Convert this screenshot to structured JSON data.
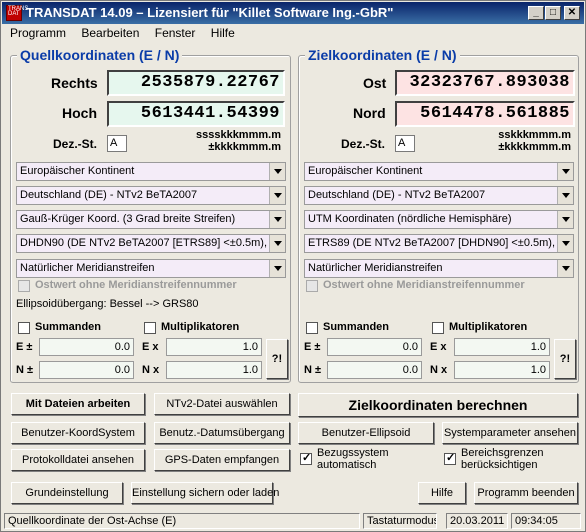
{
  "window": {
    "title": "TRANSDAT 14.09 – Lizensiert für \"Killet Software Ing.-GbR\"",
    "icon_text": "TRANS DAT",
    "minimize": "_",
    "maximize": "□",
    "close": "✕"
  },
  "menu": [
    "Programm",
    "Bearbeiten",
    "Fenster",
    "Hilfe"
  ],
  "source": {
    "title": "Quellkoordinaten (E / N)",
    "label_east": "Rechts",
    "label_north": "Hoch",
    "value_east": "2535879.22767",
    "value_north": "5613441.54399",
    "dez_label": "Dez.-St.",
    "dez_value": "A",
    "fmt1": "sssskkkmmm.m",
    "fmt2": "±kkkkmmm.m",
    "combos": [
      "Europäischer Kontinent",
      "Deutschland (DE) - NTv2 BeTA2007",
      "Gauß-Krüger Koord. (3 Grad breite Streifen)",
      "DHDN90 (DE NTv2 BeTA2007 [ETRS89] <±0.5m), E",
      "Natürlicher Meridianstreifen"
    ],
    "ostwert": "Ostwert ohne Meridianstreifennummer",
    "ellipsoid_note": "Ellipsoidübergang: Bessel --> GRS80",
    "summanden": "Summanden",
    "multiplikatoren": "Multiplikatoren",
    "e_pm": "E ±",
    "n_pm": "N ±",
    "e_x": "E x",
    "n_x": "N x",
    "sum_e": "0.0",
    "sum_n": "0.0",
    "mul_e": "1.0",
    "mul_n": "1.0",
    "help_btn": "?!"
  },
  "target": {
    "title": "Zielkoordinaten (E / N)",
    "label_east": "Ost",
    "label_north": "Nord",
    "value_east": "32323767.893038",
    "value_north": "5614478.561885",
    "dez_label": "Dez.-St.",
    "dez_value": "A",
    "fmt1": "sskkkmmm.m",
    "fmt2": "±kkkkmmm.m",
    "combos": [
      "Europäischer Kontinent",
      "Deutschland (DE) - NTv2 BeTA2007",
      "UTM Koordinaten (nördliche Hemisphäre)",
      "ETRS89 (DE NTv2 BeTA2007 [DHDN90] <±0.5m), (",
      "Natürlicher Meridianstreifen"
    ],
    "ostwert": "Ostwert ohne Meridianstreifennummer",
    "summanden": "Summanden",
    "multiplikatoren": "Multiplikatoren",
    "e_pm": "E ±",
    "n_pm": "N ±",
    "e_x": "E x",
    "n_x": "N x",
    "sum_e": "0.0",
    "sum_n": "0.0",
    "mul_e": "1.0",
    "mul_n": "1.0",
    "help_btn": "?!"
  },
  "buttons": {
    "mit_dateien": "Mit Dateien arbeiten",
    "ntv2": "NTv2-Datei auswählen",
    "zielkoord": "Zielkoordinaten berechnen",
    "benutzer_koord": "Benutzer-KoordSystem",
    "benutz_datum": "Benutz.-Datumsübergang",
    "benutzer_ellipsoid": "Benutzer-Ellipsoid",
    "systemparameter": "Systemparameter ansehen",
    "protokoll": "Protokolldatei ansehen",
    "gps": "GPS-Daten empfangen",
    "bezugssystem": "Bezugssystem automatisch",
    "bereichsgrenzen": "Bereichsgrenzen berücksichtigen",
    "grundeinstellung": "Grundeinstellung",
    "einstellung": "Einstellung sichern oder laden",
    "hilfe": "Hilfe",
    "programm_beenden": "Programm beenden"
  },
  "status": {
    "hint": "Quellkoordinate der Ost-Achse (E)",
    "mode": "Tastaturmodus",
    "date": "20.03.2011",
    "time": "09:34:05"
  }
}
